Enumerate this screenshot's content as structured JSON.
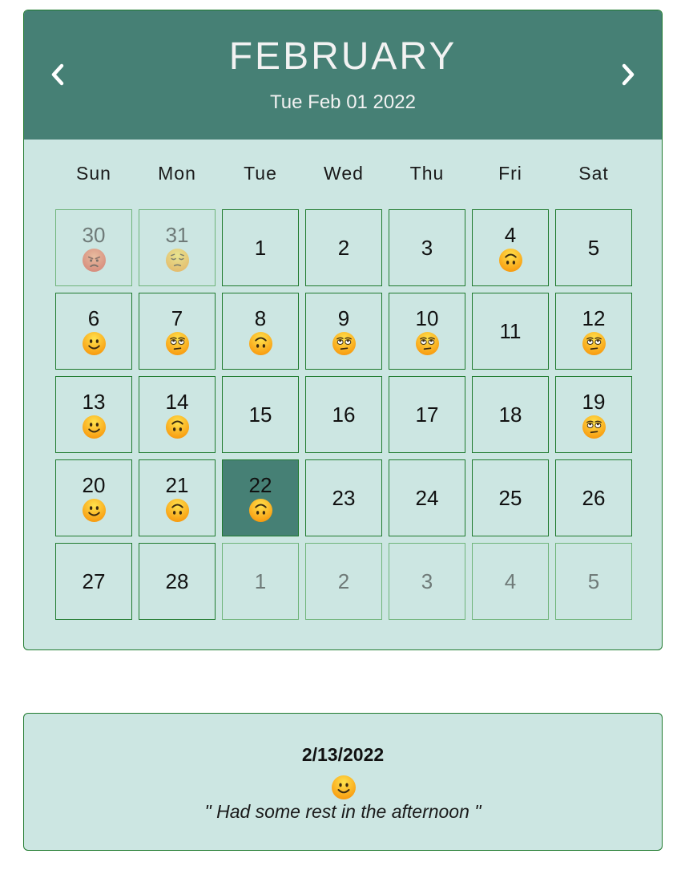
{
  "colors": {
    "header_bg": "#468075",
    "body_bg": "#cce6e2",
    "border": "#1f7a2e",
    "selected_bg": "#468075"
  },
  "header": {
    "month": "FEBRUARY",
    "date_label": "Tue Feb 01 2022",
    "prev_icon": "chevron-left-icon",
    "next_icon": "chevron-right-icon"
  },
  "weekdays": [
    "Sun",
    "Mon",
    "Tue",
    "Wed",
    "Thu",
    "Fri",
    "Sat"
  ],
  "days": [
    {
      "n": "30",
      "mood": "angry",
      "outside": true
    },
    {
      "n": "31",
      "mood": "pensive",
      "outside": true
    },
    {
      "n": "1",
      "mood": ""
    },
    {
      "n": "2",
      "mood": ""
    },
    {
      "n": "3",
      "mood": ""
    },
    {
      "n": "4",
      "mood": "upside-down"
    },
    {
      "n": "5",
      "mood": ""
    },
    {
      "n": "6",
      "mood": "smile"
    },
    {
      "n": "7",
      "mood": "eye-roll"
    },
    {
      "n": "8",
      "mood": "upside-down"
    },
    {
      "n": "9",
      "mood": "eye-roll"
    },
    {
      "n": "10",
      "mood": "eye-roll"
    },
    {
      "n": "11",
      "mood": ""
    },
    {
      "n": "12",
      "mood": "eye-roll"
    },
    {
      "n": "13",
      "mood": "smile"
    },
    {
      "n": "14",
      "mood": "upside-down"
    },
    {
      "n": "15",
      "mood": ""
    },
    {
      "n": "16",
      "mood": ""
    },
    {
      "n": "17",
      "mood": ""
    },
    {
      "n": "18",
      "mood": ""
    },
    {
      "n": "19",
      "mood": "eye-roll"
    },
    {
      "n": "20",
      "mood": "smile"
    },
    {
      "n": "21",
      "mood": "upside-down"
    },
    {
      "n": "22",
      "mood": "upside-down",
      "selected": true
    },
    {
      "n": "23",
      "mood": ""
    },
    {
      "n": "24",
      "mood": ""
    },
    {
      "n": "25",
      "mood": ""
    },
    {
      "n": "26",
      "mood": ""
    },
    {
      "n": "27",
      "mood": ""
    },
    {
      "n": "28",
      "mood": ""
    },
    {
      "n": "1",
      "mood": "",
      "outside": true
    },
    {
      "n": "2",
      "mood": "",
      "outside": true
    },
    {
      "n": "3",
      "mood": "",
      "outside": true
    },
    {
      "n": "4",
      "mood": "",
      "outside": true
    },
    {
      "n": "5",
      "mood": "",
      "outside": true
    }
  ],
  "detail": {
    "date": "2/13/2022",
    "mood": "smile",
    "note": "\" Had some rest in the afternoon \""
  }
}
